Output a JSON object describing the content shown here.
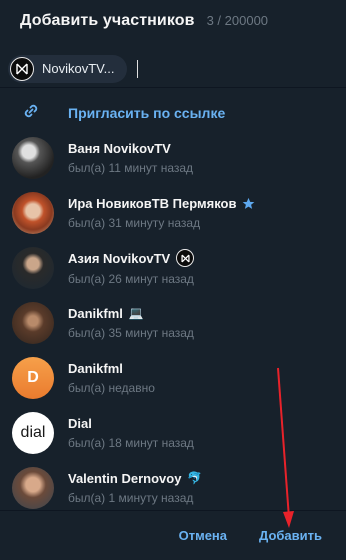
{
  "header": {
    "title": "Добавить участников",
    "count": "3 / 200000"
  },
  "chips": [
    {
      "label": "NovikovTV..."
    }
  ],
  "invite": {
    "label": "Пригласить по ссылке"
  },
  "contacts": [
    {
      "name": "Ваня NovikovTV",
      "status": "был(а) 11 минут назад",
      "avatar": "photo-dark"
    },
    {
      "name": "Ира НовиковТВ Пермяков",
      "status": "был(а) 31 минуту назад",
      "avatar": "photo-redhair",
      "badge": "star-icon"
    },
    {
      "name": "Азия NovikovTV",
      "status": "был(а) 26 минут назад",
      "avatar": "photo-portrait",
      "badge": "novikov-logo-icon"
    },
    {
      "name": "Danikfml",
      "status": "был(а) 35 минут назад",
      "avatar": "photo-room",
      "badge": "laptop-emoji"
    },
    {
      "name": "Danikfml",
      "status": "был(а) недавно",
      "avatar": "letter",
      "letter": "D"
    },
    {
      "name": "Dial",
      "status": "был(а) 18 минут назад",
      "avatar": "dial-logo",
      "logo_text": "dial"
    },
    {
      "name": "Valentin Dernovoy",
      "status": "был(а) 1 минуту назад",
      "avatar": "photo-man",
      "badge": "dolphin-emoji"
    }
  ],
  "footer": {
    "cancel_label": "Отмена",
    "add_label": "Добавить"
  },
  "colors": {
    "accent": "#6ab2f2",
    "background": "#17212b",
    "status_text": "#6d7883",
    "annotation_arrow": "#e8222a",
    "letter_avatar": "#f0803c"
  }
}
